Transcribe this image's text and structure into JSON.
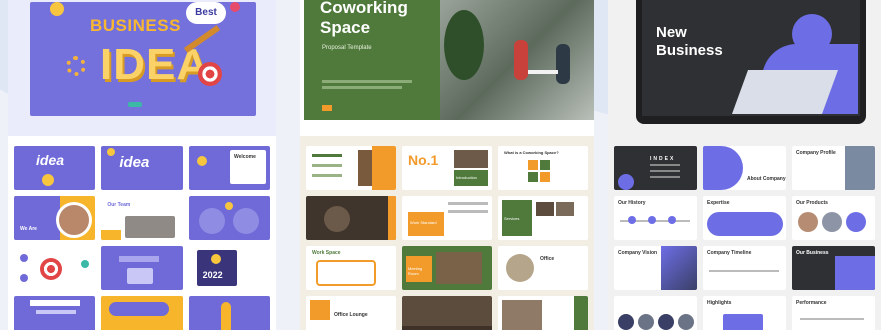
{
  "cards": [
    {
      "title_a": "BUSINESS",
      "title_b": "IDEA",
      "bubble": "Best",
      "thumb_texts": {
        "idea1": "idea",
        "idea2": "idea",
        "welcome": "Welcome",
        "we_are": "We Are",
        "our_team": "Our Team",
        "year": "2022"
      },
      "colors": {
        "primary": "#6f6ad8",
        "accent": "#f6b52a",
        "bg": "#e9e9fb"
      }
    },
    {
      "title": "Coworking Space",
      "subtitle": "Proposal Template",
      "thumb_texts": {
        "no1": "No.1",
        "what_is": "What is a Coworking Space?",
        "introduction": "Introduction",
        "services": "Services",
        "our_work": "Work Standard",
        "work_space": "Work Space",
        "meeting": "Meeting Room",
        "office": "Office",
        "office_lounge": "Office Lounge"
      },
      "colors": {
        "primary": "#4f7a3b",
        "accent": "#f29b2a",
        "bg": "#f3eee4"
      }
    },
    {
      "title": "New Business",
      "thumb_texts": {
        "index": "INDEX",
        "about": "About Company",
        "profile": "Company Profile",
        "history": "Our History",
        "expertise": "Expertise",
        "products": "Our Products",
        "vision": "Company Vision",
        "timeline": "Company Timeline",
        "business": "Our Business",
        "highlight": "Highlights",
        "performance": "Performance"
      },
      "colors": {
        "primary": "#6d6ee6",
        "dark": "#2f3033",
        "bg": "#f1f1f1"
      }
    }
  ]
}
